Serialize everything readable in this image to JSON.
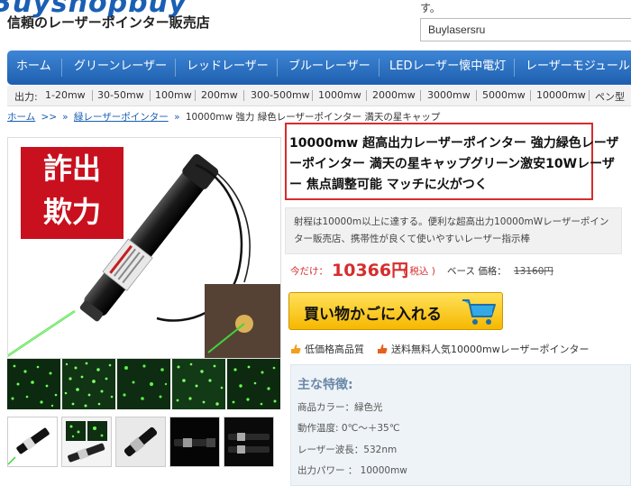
{
  "header": {
    "logo_text": "Buyshopbuy",
    "tagline": "信頼のレーザーポインター販売店",
    "note": "す。",
    "search_value": "Buylasersru"
  },
  "nav": {
    "items": [
      "ホーム",
      "グリーンレーザー",
      "レッドレーザー",
      "ブルーレーザー",
      "LEDレーザー懐中電灯",
      "レーザーモジュール"
    ]
  },
  "subnav": {
    "label": "出力:",
    "items": [
      "1-20mw",
      "30-50mw",
      "100mw",
      "200mw",
      "300-500mw",
      "1000mw",
      "2000mw",
      "3000mw",
      "5000mw",
      "10000mw",
      "ペン型"
    ]
  },
  "breadcrumb": {
    "home": "ホーム",
    "sep1": ">>",
    "sep2": "»",
    "category": "緑レーザーポインター",
    "sep3": "»",
    "current": "10000mw 強力 緑色レーザーポインター 満天の星キャップ"
  },
  "badge": {
    "line1": "詐出",
    "line2": "欺力"
  },
  "product": {
    "title": "10000mw 超高出力レーザーポインター 強力緑色レーザーポインター 満天の星キャップグリーン激安10Wレーザー 焦点調整可能 マッチに火がつく",
    "description": "射程は10000m以上に達する。便利な超高出力10000mWレーザーポインター販売店、携帯性が良くて使いやすいレーザー指示棒",
    "price_label": "今だけ：",
    "price_value": "10366円",
    "tax_label": "( 税込 )",
    "base_label": "ベース 価格：",
    "base_value": "13160円",
    "cart_label": "買い物かごに入れる",
    "feature1": "低価格高品質",
    "feature2": "送料無料人気10000mwレーザーポインター"
  },
  "specs": {
    "title": "主な特徴:",
    "lines": [
      "商品カラー：緑色光",
      "動作温度: 0℃～＋35℃",
      "レーザー波長：532nm",
      "出力パワー ： 10000mw"
    ]
  },
  "colors": {
    "accent": "#1d5fae",
    "price": "#d62d2d",
    "badge": "#c8101e",
    "cart": "#f6b800",
    "laser": "#3fd43a"
  }
}
